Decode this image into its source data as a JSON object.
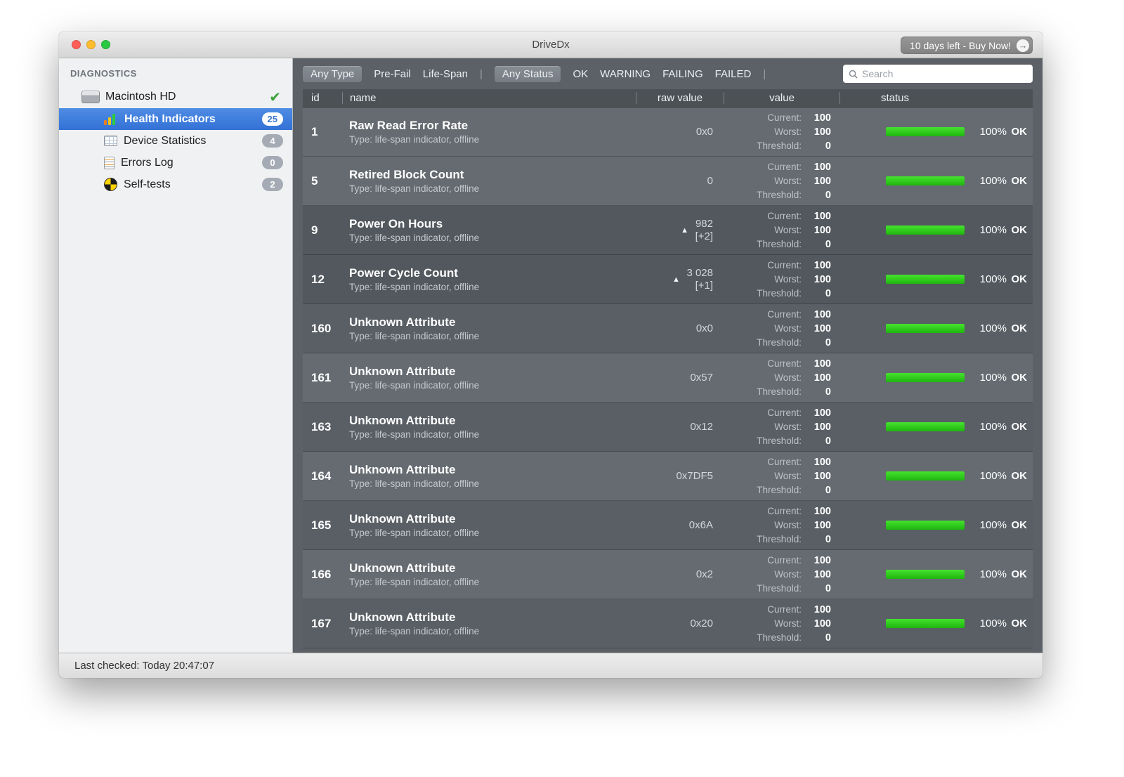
{
  "window": {
    "title": "DriveDx",
    "license": {
      "label": "10 days left - Buy Now!",
      "arrow_icon": "→"
    }
  },
  "sidebar": {
    "header": "DIAGNOSTICS",
    "device": {
      "label": "Macintosh HD",
      "check_icon": "✔"
    },
    "items": [
      {
        "label": "Health Indicators",
        "badge": "25"
      },
      {
        "label": "Device Statistics",
        "badge": "4"
      },
      {
        "label": "Errors Log",
        "badge": "0"
      },
      {
        "label": "Self-tests",
        "badge": "2"
      }
    ]
  },
  "toolbar": {
    "type_filters": [
      "Any Type",
      "Pre-Fail",
      "Life-Span"
    ],
    "status_filters": [
      "Any Status",
      "OK",
      "WARNING",
      "FAILING",
      "FAILED"
    ],
    "selected_type": "Any Type",
    "selected_status": "Any Status",
    "separator": "|",
    "search_placeholder": "Search"
  },
  "table": {
    "columns": {
      "id": "id",
      "name": "name",
      "raw": "raw value",
      "value": "value",
      "status": "status"
    },
    "labels": {
      "current": "Current:",
      "worst": "Worst:",
      "threshold": "Threshold:"
    },
    "rows": [
      {
        "id": "1",
        "name": "Raw Read Error Rate",
        "type": "Type: life-span indicator, offline",
        "trend": "",
        "raw": "0x0",
        "raw2": "",
        "current": "100",
        "worst": "100",
        "threshold": "0",
        "percent": "100%",
        "status": "OK",
        "shade": "a"
      },
      {
        "id": "5",
        "name": "Retired Block Count",
        "type": "Type: life-span indicator, offline",
        "trend": "",
        "raw": "0",
        "raw2": "",
        "current": "100",
        "worst": "100",
        "threshold": "0",
        "percent": "100%",
        "status": "OK",
        "shade": "a"
      },
      {
        "id": "9",
        "name": "Power On Hours",
        "type": "Type: life-span indicator, offline",
        "trend": "▲",
        "raw": "982",
        "raw2": "[+2]",
        "current": "100",
        "worst": "100",
        "threshold": "0",
        "percent": "100%",
        "status": "OK",
        "shade": "c"
      },
      {
        "id": "12",
        "name": "Power Cycle Count",
        "type": "Type: life-span indicator, offline",
        "trend": "▲",
        "raw": "3 028",
        "raw2": "[+1]",
        "current": "100",
        "worst": "100",
        "threshold": "0",
        "percent": "100%",
        "status": "OK",
        "shade": "c"
      },
      {
        "id": "160",
        "name": "Unknown Attribute",
        "type": "Type: life-span indicator, offline",
        "trend": "",
        "raw": "0x0",
        "raw2": "",
        "current": "100",
        "worst": "100",
        "threshold": "0",
        "percent": "100%",
        "status": "OK",
        "shade": "b"
      },
      {
        "id": "161",
        "name": "Unknown Attribute",
        "type": "Type: life-span indicator, offline",
        "trend": "",
        "raw": "0x57",
        "raw2": "",
        "current": "100",
        "worst": "100",
        "threshold": "0",
        "percent": "100%",
        "status": "OK",
        "shade": "a"
      },
      {
        "id": "163",
        "name": "Unknown Attribute",
        "type": "Type: life-span indicator, offline",
        "trend": "",
        "raw": "0x12",
        "raw2": "",
        "current": "100",
        "worst": "100",
        "threshold": "0",
        "percent": "100%",
        "status": "OK",
        "shade": "b"
      },
      {
        "id": "164",
        "name": "Unknown Attribute",
        "type": "Type: life-span indicator, offline",
        "trend": "",
        "raw": "0x7DF5",
        "raw2": "",
        "current": "100",
        "worst": "100",
        "threshold": "0",
        "percent": "100%",
        "status": "OK",
        "shade": "a"
      },
      {
        "id": "165",
        "name": "Unknown Attribute",
        "type": "Type: life-span indicator, offline",
        "trend": "",
        "raw": "0x6A",
        "raw2": "",
        "current": "100",
        "worst": "100",
        "threshold": "0",
        "percent": "100%",
        "status": "OK",
        "shade": "b"
      },
      {
        "id": "166",
        "name": "Unknown Attribute",
        "type": "Type: life-span indicator, offline",
        "trend": "",
        "raw": "0x2",
        "raw2": "",
        "current": "100",
        "worst": "100",
        "threshold": "0",
        "percent": "100%",
        "status": "OK",
        "shade": "a"
      },
      {
        "id": "167",
        "name": "Unknown Attribute",
        "type": "Type: life-span indicator, offline",
        "trend": "",
        "raw": "0x20",
        "raw2": "",
        "current": "100",
        "worst": "100",
        "threshold": "0",
        "percent": "100%",
        "status": "OK",
        "shade": "b"
      }
    ]
  },
  "statusbar": {
    "last_checked": "Last checked: Today 20:47:07"
  },
  "colors": {
    "ok_green": "#2ed019",
    "selection_blue": "#3b7de0"
  }
}
